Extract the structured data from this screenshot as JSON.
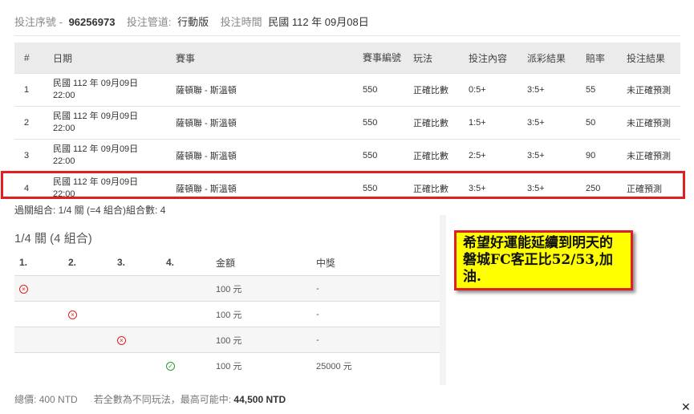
{
  "header": {
    "serial_label": "投注序號 -",
    "serial_value": "96256973",
    "channel_label": "投注管道:",
    "channel_value": "行動版",
    "time_label": "投注時間",
    "time_value": "民國 112 年 09月08日"
  },
  "bets_table": {
    "headers": [
      "#",
      "日期",
      "賽事",
      "賽事編號",
      "玩法",
      "投注內容",
      "派彩結果",
      "賠率",
      "投注結果"
    ],
    "rows": [
      {
        "no": "1",
        "date_line1": "民國 112 年 09月09日",
        "date_line2": "22:00",
        "match": "薩頓聯 - 斯溫頓",
        "match_id": "550",
        "play": "正確比數",
        "pick": "0:5+",
        "result": "3:5+",
        "odds": "55",
        "outcome": "未正確預測"
      },
      {
        "no": "2",
        "date_line1": "民國 112 年 09月09日",
        "date_line2": "22:00",
        "match": "薩頓聯 - 斯溫頓",
        "match_id": "550",
        "play": "正確比數",
        "pick": "1:5+",
        "result": "3:5+",
        "odds": "50",
        "outcome": "未正確預測"
      },
      {
        "no": "3",
        "date_line1": "民國 112 年 09月09日",
        "date_line2": "22:00",
        "match": "薩頓聯 - 斯溫頓",
        "match_id": "550",
        "play": "正確比數",
        "pick": "2:5+",
        "result": "3:5+",
        "odds": "90",
        "outcome": "未正確預測"
      },
      {
        "no": "4",
        "date_line1": "民國 112 年 09月09日",
        "date_line2": "22:00",
        "match": "薩頓聯 - 斯溫頓",
        "match_id": "550",
        "play": "正確比數",
        "pick": "3:5+",
        "result": "3:5+",
        "odds": "250",
        "outcome": "正確預測"
      }
    ]
  },
  "combo_summary": "過關組合: 1/4 關 (=4 組合)組合數: 4",
  "combo_section": {
    "title": "1/4 關 (4 組合)",
    "headers": [
      "1.",
      "2.",
      "3.",
      "4.",
      "金額",
      "中獎"
    ],
    "rows": [
      {
        "amount": "100 元",
        "win": "-"
      },
      {
        "amount": "100 元",
        "win": "-"
      },
      {
        "amount": "100 元",
        "win": "-"
      },
      {
        "amount": "100 元",
        "win": "25000 元"
      }
    ]
  },
  "note": "希望好運能延續到明天的磐城FC客正比52/53,加油.",
  "footer": {
    "total_label": "總價:",
    "total_value": "400 NTD",
    "max_label": "若全數為不同玩法，最高可能中:",
    "max_value": "44,500 NTD"
  },
  "icons": {
    "lost": "x-circle-icon",
    "won": "check-circle-icon",
    "close": "close-icon"
  },
  "colors": {
    "highlight": "#e02020",
    "note_bg": "#ffff00",
    "lost": "#d22222",
    "won": "#2a9a2a"
  }
}
